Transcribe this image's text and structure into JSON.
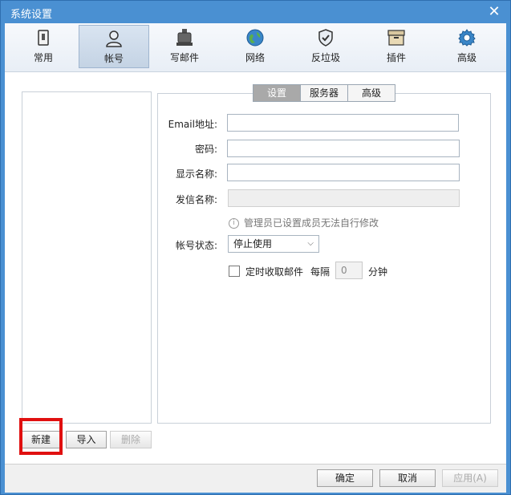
{
  "window": {
    "title": "系统设置"
  },
  "toolbar": {
    "items": [
      {
        "label": "常用",
        "icon": "common-settings-icon"
      },
      {
        "label": "帐号",
        "icon": "account-person-icon"
      },
      {
        "label": "写邮件",
        "icon": "compose-icon"
      },
      {
        "label": "网络",
        "icon": "globe-icon"
      },
      {
        "label": "反垃圾",
        "icon": "shield-check-icon"
      },
      {
        "label": "插件",
        "icon": "plugin-box-icon"
      },
      {
        "label": "高级",
        "icon": "gear-icon"
      }
    ],
    "active_index": 1
  },
  "tabs": {
    "items": [
      "设置",
      "服务器",
      "高级"
    ],
    "active_index": 0
  },
  "form": {
    "email_label": "Email地址:",
    "email_value": "",
    "password_label": "密码:",
    "password_value": "",
    "display_name_label": "显示名称:",
    "display_name_value": "",
    "sender_name_label": "发信名称:",
    "sender_name_value": "",
    "admin_note": "管理员已设置成员无法自行修改",
    "status_label": "帐号状态:",
    "status_value": "停止使用",
    "timed_fetch_label": "定时收取邮件",
    "timed_fetch_checked": false,
    "every_label": "每隔",
    "interval_value": "0",
    "minutes_label": "分钟"
  },
  "account_buttons": {
    "new": "新建",
    "import": "导入",
    "delete": "删除"
  },
  "footer": {
    "ok": "确定",
    "cancel": "取消",
    "apply": "应用(A)"
  },
  "colors": {
    "title_bar": "#4a90d2",
    "highlight": "#e01010",
    "active_tab": "#a9a9a9"
  }
}
